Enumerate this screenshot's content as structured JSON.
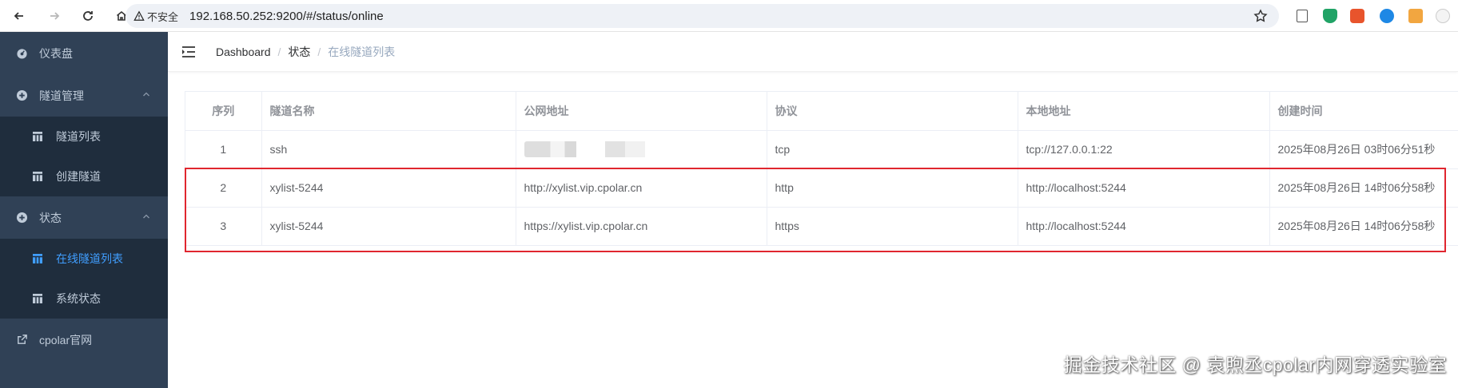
{
  "browser": {
    "security_label": "不安全",
    "url": "192.168.50.252:9200/#/status/online"
  },
  "sidebar": {
    "items": [
      {
        "label": "仪表盘",
        "icon": "dashboard-icon"
      },
      {
        "label": "隧道管理",
        "icon": "plus-circle-icon",
        "expanded": true,
        "children": [
          {
            "label": "隧道列表",
            "icon": "table-icon"
          },
          {
            "label": "创建隧道",
            "icon": "table-icon"
          }
        ]
      },
      {
        "label": "状态",
        "icon": "plus-circle-icon",
        "expanded": true,
        "children": [
          {
            "label": "在线隧道列表",
            "icon": "table-icon",
            "active": true
          },
          {
            "label": "系统状态",
            "icon": "table-icon"
          }
        ]
      },
      {
        "label": "cpolar官网",
        "icon": "external-link-icon"
      }
    ]
  },
  "breadcrumb": [
    "Dashboard",
    "状态",
    "在线隧道列表"
  ],
  "table": {
    "headers": [
      "序列",
      "隧道名称",
      "公网地址",
      "协议",
      "本地地址",
      "创建时间"
    ],
    "rows": [
      [
        "1",
        "ssh",
        "",
        "tcp",
        "tcp://127.0.0.1:22",
        "2025年08月26日 03时06分51秒"
      ],
      [
        "2",
        "xylist-5244",
        "http://xylist.vip.cpolar.cn",
        "http",
        "http://localhost:5244",
        "2025年08月26日 14时06分58秒"
      ],
      [
        "3",
        "xylist-5244",
        "https://xylist.vip.cpolar.cn",
        "https",
        "http://localhost:5244",
        "2025年08月26日 14时06分58秒"
      ]
    ]
  },
  "watermark": "掘金技术社区 @ 袁煦丞cpolar内网穿透实验室",
  "colors": {
    "sidebar_bg": "#304156",
    "submenu_bg": "#1f2d3d",
    "active": "#409eff",
    "highlight": "#e0262f"
  }
}
